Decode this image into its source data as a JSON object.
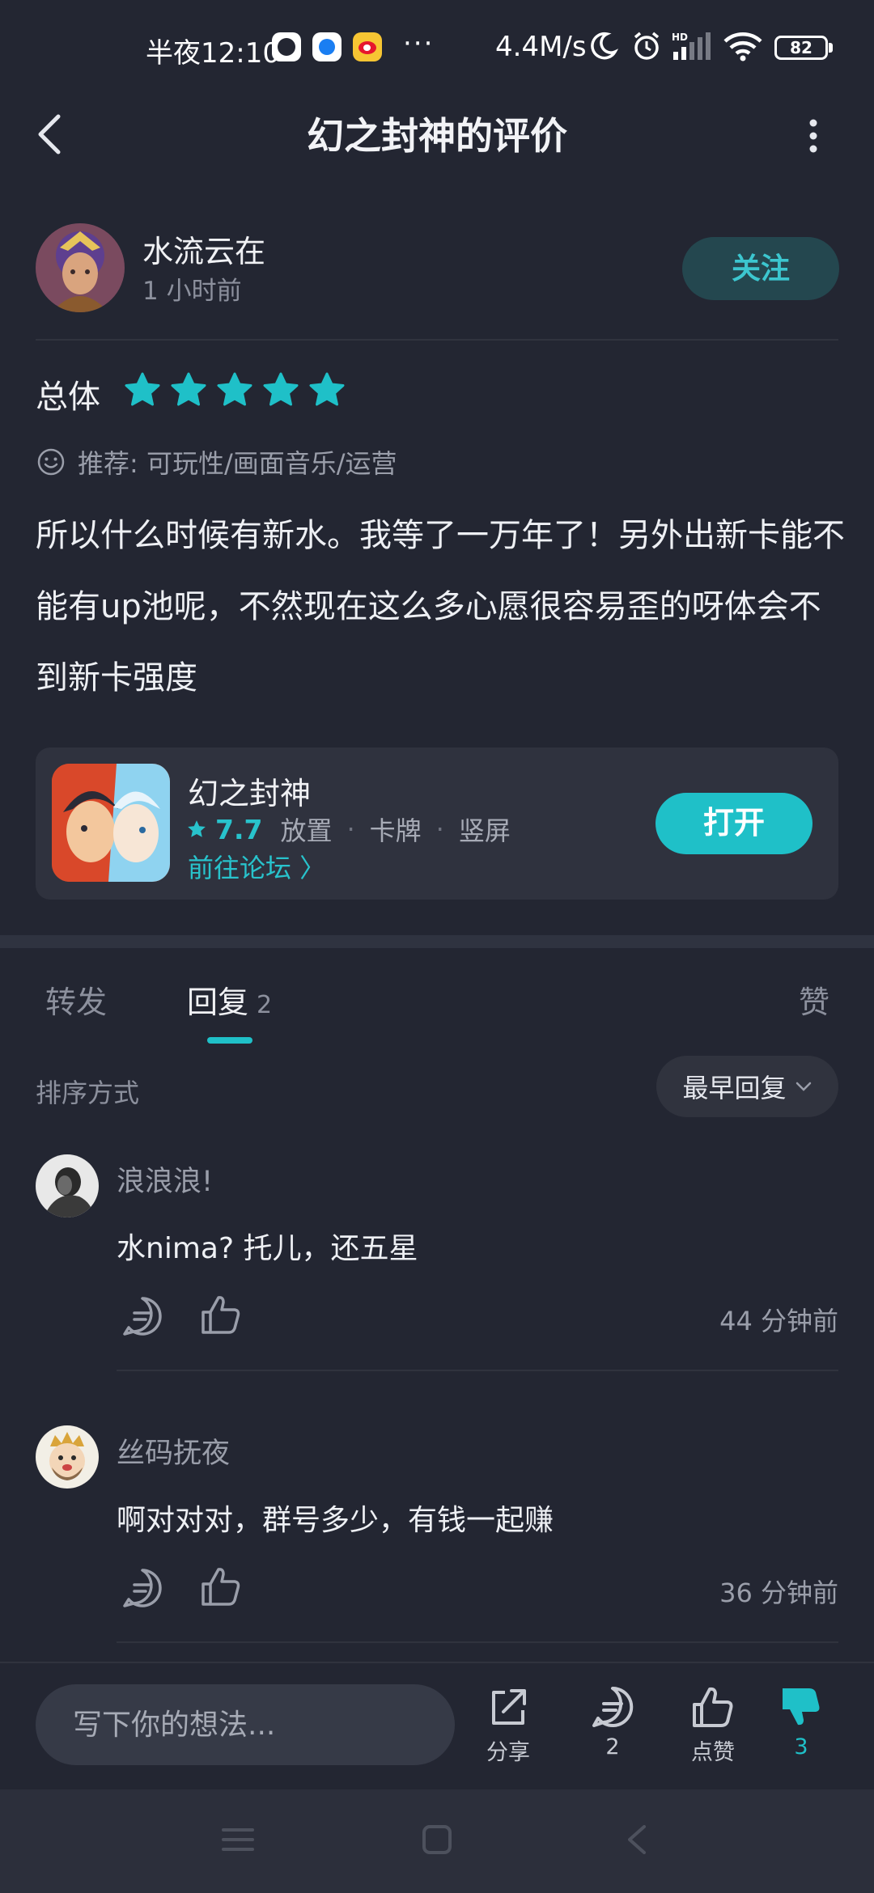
{
  "status_bar": {
    "time": "半夜12:10",
    "more_dots": "···",
    "net_speed": "4.4M/s",
    "battery": "82",
    "icons": [
      "white-circle-app-icon",
      "blue-app-icon",
      "weibo-icon",
      "moon-icon",
      "alarm-icon",
      "hd-signal-icon",
      "wifi-icon",
      "battery-icon"
    ]
  },
  "header": {
    "title": "幻之封神的评价",
    "back_icon": "back-chevron-icon",
    "more_icon": "more-vertical-icon"
  },
  "review": {
    "author": "水流云在",
    "time": "1 小时前",
    "follow_label": "关注",
    "rating_label": "总体",
    "stars": 5,
    "recommend_text": "推荐: 可玩性/画面音乐/运营",
    "body": "所以什么时候有新水。我等了一万年了！另外出新卡能不能有up池呢，不然现在这么多心愿很容易歪的呀体会不到新卡强度"
  },
  "game_card": {
    "name": "幻之封神",
    "score": "7.7",
    "tags": [
      "放置",
      "卡牌",
      "竖屏"
    ],
    "forum_link": "前往论坛 〉",
    "open_label": "打开"
  },
  "tabs": {
    "forward": "转发",
    "reply": "回复",
    "reply_count": "2",
    "like": "赞"
  },
  "sort": {
    "label": "排序方式",
    "selected": "最早回复"
  },
  "comments": [
    {
      "name": "浪浪浪!",
      "text": "水nima? 托儿，还五星",
      "time": "44 分钟前"
    },
    {
      "name": "丝码抚夜",
      "text": "啊对对对，群号多少，有钱一起赚",
      "time": "36 分钟前"
    }
  ],
  "bottom_bar": {
    "input_placeholder": "写下你的想法...",
    "share_label": "分享",
    "comment_count": "2",
    "like_label": "点赞",
    "dislike_count": "3"
  },
  "colors": {
    "background": "#232632",
    "accent": "#1fc0c8",
    "card": "#2f323e",
    "text_primary": "#f0f1f4",
    "text_secondary": "#8c909d"
  }
}
